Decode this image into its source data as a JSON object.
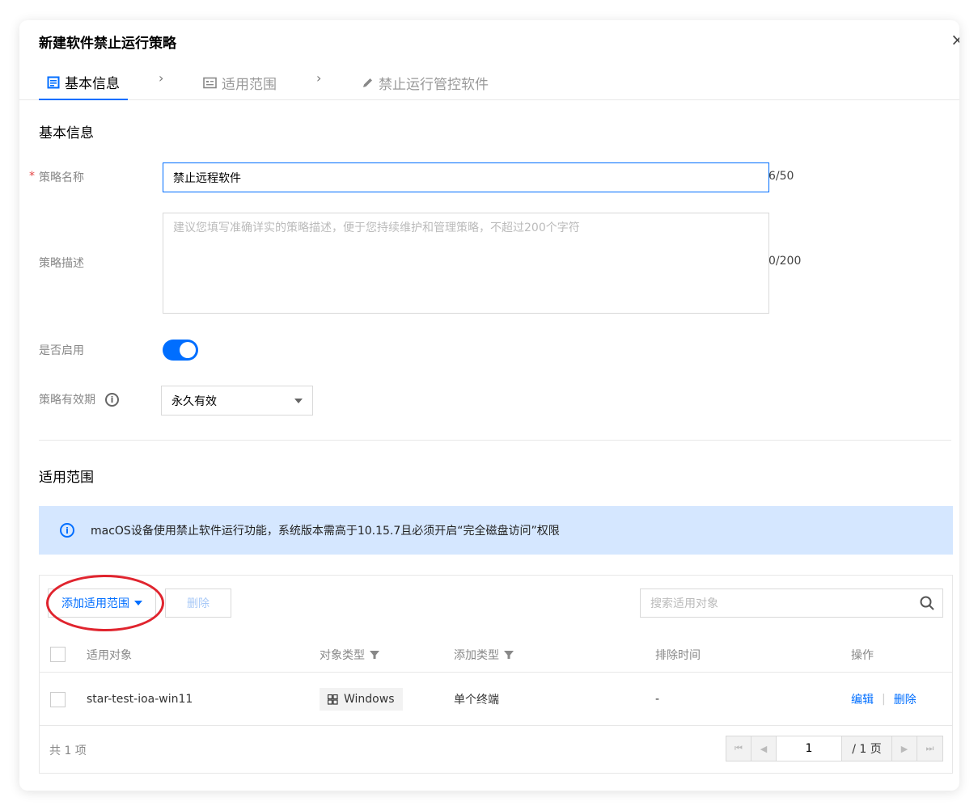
{
  "dialog": {
    "title": "新建软件禁止运行策略",
    "close_glyph": "×"
  },
  "steps": [
    {
      "label": "基本信息",
      "icon": "form-icon",
      "active": true
    },
    {
      "label": "适用范围",
      "icon": "id-card-icon",
      "active": false
    },
    {
      "label": "禁止运行管控软件",
      "icon": "pencil-icon",
      "active": false
    }
  ],
  "step_arrow": "›",
  "basic": {
    "section_title": "基本信息",
    "required_mark": "*",
    "name_label": "策略名称",
    "name_value": "禁止远程软件",
    "name_count": "6/50",
    "desc_label": "策略描述",
    "desc_placeholder": "建议您填写准确详实的策略描述，便于您持续维护和管理策略，不超过200个字符",
    "desc_count": "0/200",
    "enable_label": "是否启用",
    "enabled": true,
    "validity_label": "策略有效期",
    "validity_value": "永久有效"
  },
  "scope": {
    "section_title": "适用范围",
    "notice": "macOS设备使用禁止软件运行功能，系统版本需高于10.15.7且必须开启“完全磁盘访问”权限",
    "add_button": "添加适用范围",
    "delete_button": "删除",
    "search_placeholder": "搜索适用对象",
    "columns": [
      "适用对象",
      "对象类型",
      "添加类型",
      "排除时间",
      "操作"
    ],
    "rows": [
      {
        "target": "star-test-ioa-win11",
        "type": "Windows",
        "add_type": "单个终端",
        "exclude_time": "-",
        "edit": "编辑",
        "delete": "删除"
      }
    ],
    "total": "共 1 项",
    "page_value": "1",
    "page_total": "/ 1 页"
  },
  "colors": {
    "accent": "#006eff",
    "notice_bg": "#d5e7ff",
    "annotation": "#e0242e"
  }
}
